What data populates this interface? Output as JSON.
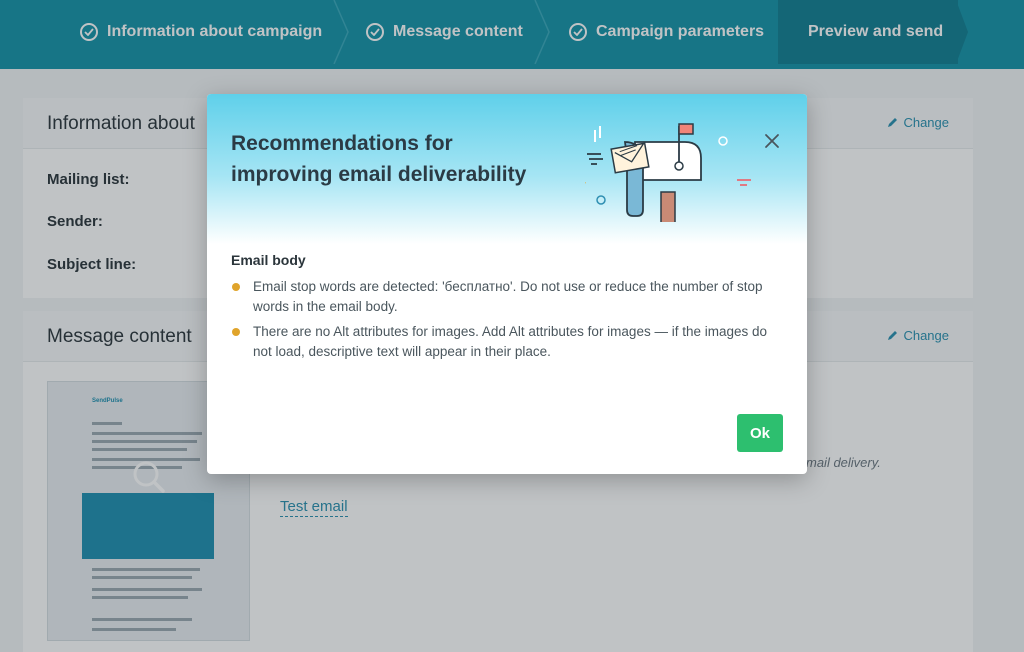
{
  "stepper": {
    "steps": [
      {
        "label": "Information about campaign",
        "completed": true
      },
      {
        "label": "Message content",
        "completed": true
      },
      {
        "label": "Campaign parameters",
        "completed": true
      },
      {
        "label": "Preview and send",
        "completed": false,
        "active": true
      }
    ]
  },
  "page": {
    "info_panel": {
      "title": "Information about",
      "change_label": "Change",
      "fields": [
        "Mailing list:",
        "Sender:",
        "Subject line:"
      ]
    },
    "content_panel": {
      "title": "Message content",
      "change_label": "Change",
      "side_note": "mail delivery.",
      "test_email_label": "Test email",
      "thumbnail_brand": "SendPulse"
    }
  },
  "modal": {
    "title": "Recommendations for improving email deliverability",
    "section_heading": "Email body",
    "recommendations": [
      "Email stop words are detected: 'бесплатно'. Do not use or reduce the number of stop words in the email body.",
      "There are no Alt attributes for images. Add Alt attributes for images — if the images do not load, descriptive text will appear in their place."
    ],
    "ok_label": "Ok"
  },
  "colors": {
    "header": "#1693a8",
    "header_active": "#117f92",
    "link": "#2a90b0",
    "ok_button": "#2dbf6f",
    "bullet": "#e0a42b"
  },
  "icons": {
    "step_check": "check-circle-icon",
    "change": "pencil-icon",
    "close": "close-icon",
    "illustration": "mailbox-illustration",
    "thumbnail_zoom": "magnifier-icon"
  }
}
